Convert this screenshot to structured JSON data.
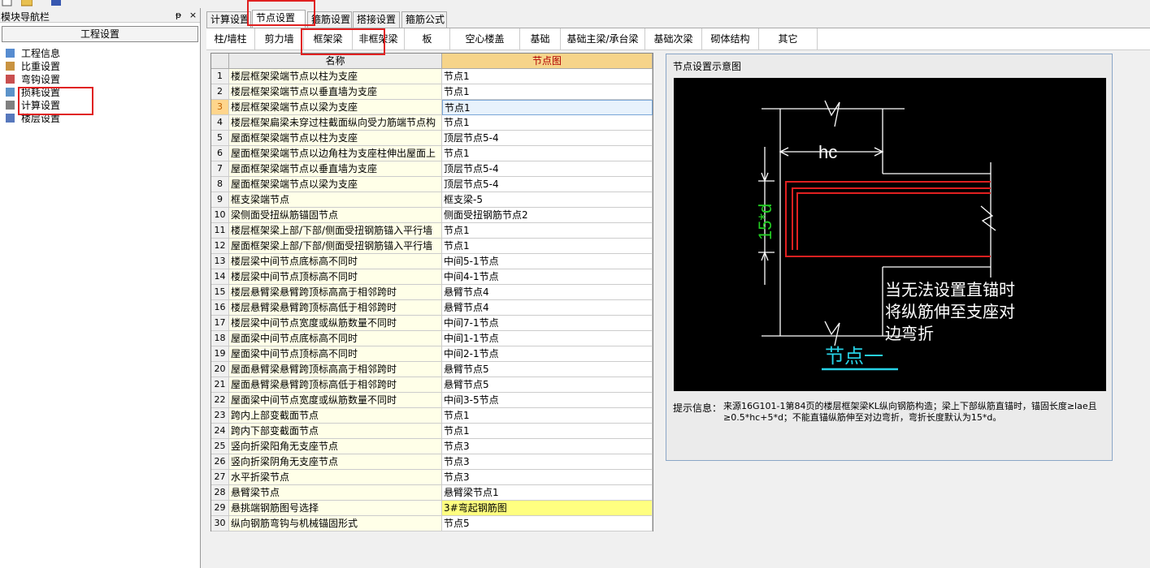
{
  "left_panel": {
    "title": "模块导航栏",
    "pin_glyph": "ᵽ",
    "close_glyph": "×",
    "header": "工程设置",
    "items": [
      {
        "label": "工程信息",
        "icon": "info-icon"
      },
      {
        "label": "比重设置",
        "icon": "weight-icon"
      },
      {
        "label": "弯钩设置",
        "icon": "hook-icon"
      },
      {
        "label": "损耗设置",
        "icon": "loss-icon"
      },
      {
        "label": "计算设置",
        "icon": "calc-icon"
      },
      {
        "label": "楼层设置",
        "icon": "floor-icon"
      }
    ]
  },
  "tabs": [
    "计算设置",
    "节点设置",
    "箍筋设置",
    "搭接设置",
    "箍筋公式"
  ],
  "active_tab": 1,
  "subtabs": [
    "柱/墙柱",
    "剪力墙",
    "框架梁",
    "非框架梁",
    "板",
    "空心楼盖",
    "基础",
    "基础主梁/承台梁",
    "基础次梁",
    "砌体结构",
    "其它"
  ],
  "grid": {
    "col_name": "名称",
    "col_node": "节点图",
    "selected_row": 3,
    "rows": [
      {
        "num": "1",
        "name": "楼层框架梁端节点以柱为支座",
        "node": "节点1"
      },
      {
        "num": "2",
        "name": "楼层框架梁端节点以垂直墙为支座",
        "node": "节点1"
      },
      {
        "num": "3",
        "name": "楼层框架梁端节点以梁为支座",
        "node": "节点1"
      },
      {
        "num": "4",
        "name": "楼层框架扁梁未穿过柱截面纵向受力筋端节点构",
        "node": "节点1"
      },
      {
        "num": "5",
        "name": "屋面框架梁端节点以柱为支座",
        "node": "顶层节点5-4"
      },
      {
        "num": "6",
        "name": "屋面框架梁端节点以边角柱为支座柱伸出屋面上",
        "node": "节点1"
      },
      {
        "num": "7",
        "name": "屋面框架梁端节点以垂直墙为支座",
        "node": "顶层节点5-4"
      },
      {
        "num": "8",
        "name": "屋面框架梁端节点以梁为支座",
        "node": "顶层节点5-4"
      },
      {
        "num": "9",
        "name": "框支梁端节点",
        "node": "框支梁-5"
      },
      {
        "num": "10",
        "name": "梁侧面受扭纵筋锚固节点",
        "node": "侧面受扭钢筋节点2"
      },
      {
        "num": "11",
        "name": "楼层框架梁上部/下部/侧面受扭钢筋锚入平行墙",
        "node": "节点1"
      },
      {
        "num": "12",
        "name": "屋面框架梁上部/下部/侧面受扭钢筋锚入平行墙",
        "node": "节点1"
      },
      {
        "num": "13",
        "name": "楼层梁中间节点底标高不同时",
        "node": "中间5-1节点"
      },
      {
        "num": "14",
        "name": "楼层梁中间节点顶标高不同时",
        "node": "中间4-1节点"
      },
      {
        "num": "15",
        "name": "楼层悬臂梁悬臂跨顶标高高于相邻跨时",
        "node": "悬臂节点4"
      },
      {
        "num": "16",
        "name": "楼层悬臂梁悬臂跨顶标高低于相邻跨时",
        "node": "悬臂节点4"
      },
      {
        "num": "17",
        "name": "楼层梁中间节点宽度或纵筋数量不同时",
        "node": "中间7-1节点"
      },
      {
        "num": "18",
        "name": "屋面梁中间节点底标高不同时",
        "node": "中间1-1节点"
      },
      {
        "num": "19",
        "name": "屋面梁中间节点顶标高不同时",
        "node": "中间2-1节点"
      },
      {
        "num": "20",
        "name": "屋面悬臂梁悬臂跨顶标高高于相邻跨时",
        "node": "悬臂节点5"
      },
      {
        "num": "21",
        "name": "屋面悬臂梁悬臂跨顶标高低于相邻跨时",
        "node": "悬臂节点5"
      },
      {
        "num": "22",
        "name": "屋面梁中间节点宽度或纵筋数量不同时",
        "node": "中间3-5节点"
      },
      {
        "num": "23",
        "name": "跨内上部变截面节点",
        "node": "节点1"
      },
      {
        "num": "24",
        "name": "跨内下部变截面节点",
        "node": "节点1"
      },
      {
        "num": "25",
        "name": "竖向折梁阳角无支座节点",
        "node": "节点3"
      },
      {
        "num": "26",
        "name": "竖向折梁阴角无支座节点",
        "node": "节点3"
      },
      {
        "num": "27",
        "name": "水平折梁节点",
        "node": "节点3"
      },
      {
        "num": "28",
        "name": "悬臂梁节点",
        "node": "悬臂梁节点1"
      },
      {
        "num": "29",
        "name": "悬挑端钢筋图号选择",
        "node": "3#弯起钢筋图"
      },
      {
        "num": "30",
        "name": "纵向钢筋弯钩与机械锚固形式",
        "node": "节点5"
      }
    ]
  },
  "diagram": {
    "title": "节点设置示意图",
    "hc": "hc",
    "dim": "15*d",
    "note": [
      "当无法设置直锚时",
      "将纵筋伸至支座对",
      "边弯折"
    ],
    "node_label": "节点一",
    "hint_label": "提示信息：",
    "hint_text": "来源16G101-1第84页的楼层框架梁KL纵向钢筋构造；梁上下部纵筋直锚时，锚固长度≥lae且≥0.5*hc+5*d；不能直锚纵筋伸至对边弯折，弯折长度默认为15*d。"
  },
  "colors": {
    "accent_red": "#e02020",
    "header_orange": "#f6d48a",
    "cyan": "#27d2e6",
    "green": "#22cc22"
  }
}
